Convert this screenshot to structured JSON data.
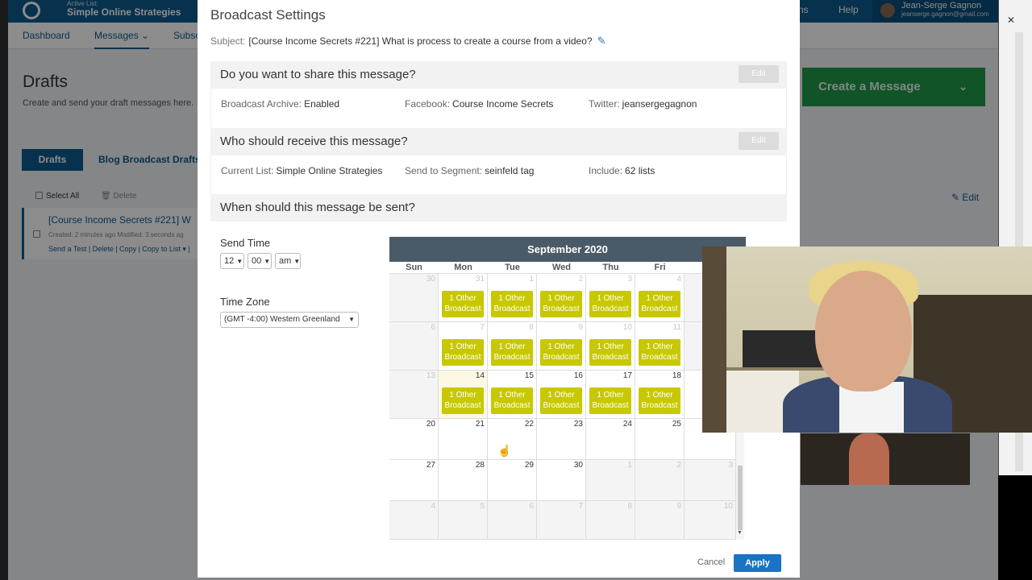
{
  "app": {
    "active_list_label": "Active List:",
    "active_list_name": "Simple Online Strategies",
    "help": "Help",
    "ns": "ns",
    "user_name": "Jean-Serge Gagnon",
    "user_email": "jeanserge.gagnon@gmail.com",
    "nav": [
      "Dashboard",
      "Messages",
      "Subsc"
    ],
    "page_title": "Drafts",
    "page_subtitle": "Create and send your draft messages here.",
    "tabs": [
      "Drafts",
      "Blog Broadcast Drafts"
    ],
    "select_all": "Select All",
    "delete": "Delete",
    "draft": {
      "title": "[Course Income Secrets #221] W",
      "meta": "Created: 2 minutes ago   Modified: 3 seconds ag",
      "actions": "Send a Test | Delete | Copy | Copy to List ▾ |"
    },
    "create_message": "Create a Message",
    "edit": "Edit"
  },
  "modal": {
    "title": "Broadcast Settings",
    "subject_label": "Subject:",
    "subject_value": "[Course Income Secrets #221] What is process to create a course from a video?",
    "share": {
      "title": "Do you want to share this message?",
      "edit": "Edit",
      "archive_label": "Broadcast Archive:",
      "archive_value": "Enabled",
      "facebook_label": "Facebook:",
      "facebook_value": "Course Income Secrets",
      "twitter_label": "Twitter:",
      "twitter_value": "jeansergegagnon"
    },
    "receive": {
      "title": "Who should receive this message?",
      "edit": "Edit",
      "list_label": "Current List:",
      "list_value": "Simple Online Strategies",
      "segment_label": "Send to Segment:",
      "segment_value": "seinfeld tag",
      "include_label": "Include:",
      "include_value": "62 lists"
    },
    "when": {
      "title": "When should this message be sent?",
      "send_time_label": "Send Time",
      "hour": "12",
      "minute": "00",
      "ampm": "am",
      "timezone_label": "Time Zone",
      "timezone_value": "(GMT -4:00) Western Greenland"
    },
    "cancel": "Cancel",
    "apply": "Apply"
  },
  "calendar": {
    "month": "September 2020",
    "days_of_week": [
      "Sun",
      "Mon",
      "Tue",
      "Wed",
      "Thu",
      "Fri"
    ],
    "event_line1": "1 Other",
    "event_line2": "Broadcast",
    "today": "14"
  }
}
